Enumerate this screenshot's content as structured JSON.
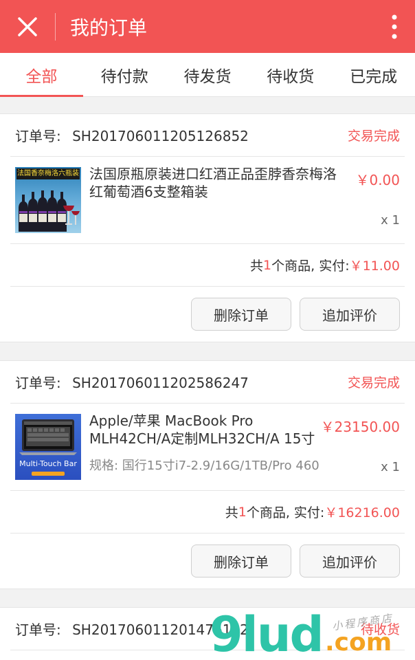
{
  "header": {
    "title": "我的订单"
  },
  "tabs": [
    "全部",
    "待付款",
    "待发货",
    "待收货",
    "已完成"
  ],
  "orders": [
    {
      "number_label": "订单号:",
      "number": "SH201706011205126852",
      "status": "交易完成",
      "product": {
        "name": "法国原瓶原装进口红酒正品歪脖香奈梅洛红葡萄酒6支整箱装",
        "spec": "",
        "price": "￥0.00",
        "qty": "x 1",
        "thumb_banner": "法国香奈梅洛六瓶装"
      },
      "summary": {
        "pre": "共",
        "count": "1",
        "mid": "个商品, 实付:",
        "paid": "￥11.00"
      },
      "actions": {
        "delete": "删除订单",
        "review": "追加评价"
      }
    },
    {
      "number_label": "订单号:",
      "number": "SH201706011202586247",
      "status": "交易完成",
      "product": {
        "name": "Apple/苹果 MacBook Pro MLH42CH/A定制MLH32CH/A 15寸",
        "spec": "规格: 国行15寸i7-2.9/16G/1TB/Pro 460",
        "price": "￥23150.00",
        "qty": "x 1",
        "thumb_banner": "Multi-Touch Bar"
      },
      "summary": {
        "pre": "共",
        "count": "1",
        "mid": "个商品, 实付:",
        "paid": "￥16216.00"
      },
      "actions": {
        "delete": "删除订单",
        "review": "追加评价"
      }
    },
    {
      "number_label": "订单号:",
      "number": "SH201706011201476192",
      "status": "待收货"
    }
  ],
  "watermark": {
    "brand": "9lud",
    "suffix": ".com",
    "tagline": "小程序商店"
  },
  "colors": {
    "accent": "#f25454"
  }
}
